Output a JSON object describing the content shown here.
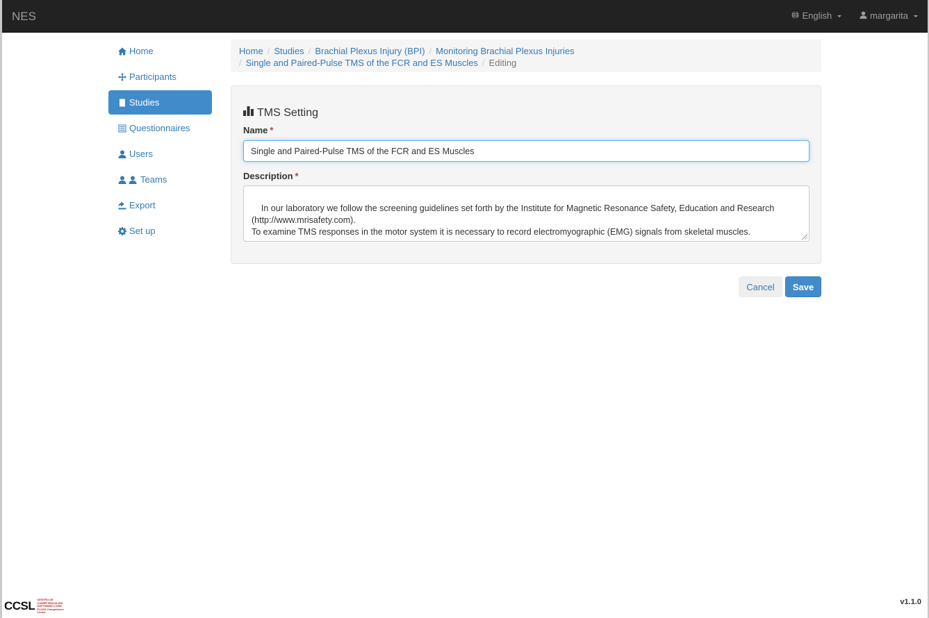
{
  "navbar": {
    "brand": "NES",
    "language": "English",
    "user": "margarita"
  },
  "sidebar": {
    "items": [
      {
        "label": "Home",
        "icon": "home-icon"
      },
      {
        "label": "Participants",
        "icon": "move-icon"
      },
      {
        "label": "Studies",
        "icon": "book-icon",
        "active": true
      },
      {
        "label": "Questionnaires",
        "icon": "list-alt-icon"
      },
      {
        "label": "Users",
        "icon": "user-icon"
      },
      {
        "label": "Teams",
        "icon": "users-icon"
      },
      {
        "label": "Export",
        "icon": "export-icon"
      },
      {
        "label": "Set up",
        "icon": "cog-icon"
      }
    ]
  },
  "breadcrumb": {
    "items": [
      "Home",
      "Studies",
      "Brachial Plexus Injury (BPI)",
      "Monitoring Brachial Plexus Injuries",
      "Single and Paired-Pulse TMS of the FCR and ES Muscles"
    ],
    "current": "Editing"
  },
  "form": {
    "title": "TMS Setting",
    "name_label": "Name",
    "required_mark": "*",
    "name_value": "Single and Paired-Pulse TMS of the FCR and ES Muscles",
    "description_label": "Description",
    "description_value": "In our laboratory we follow the screening guidelines set forth by the Institute for Magnetic Resonance Safety, Education and Research\n(http://www.mrisafety.com).\nTo examine TMS responses in the motor system it is necessary to record electromyographic (EMG) signals from skeletal muscles."
  },
  "buttons": {
    "cancel": "Cancel",
    "save": "Save"
  },
  "footer": {
    "logo_text": "CCSL",
    "logo_subtext": "CENTRO DE COMPETÊNCIA EM SOFTWARE LIVRE FLOSS Competence Center",
    "version": "v1.1.0"
  },
  "colors": {
    "navbar_bg": "#222222",
    "link": "#337ab7",
    "active_bg": "#428bca",
    "required": "#a94442"
  }
}
